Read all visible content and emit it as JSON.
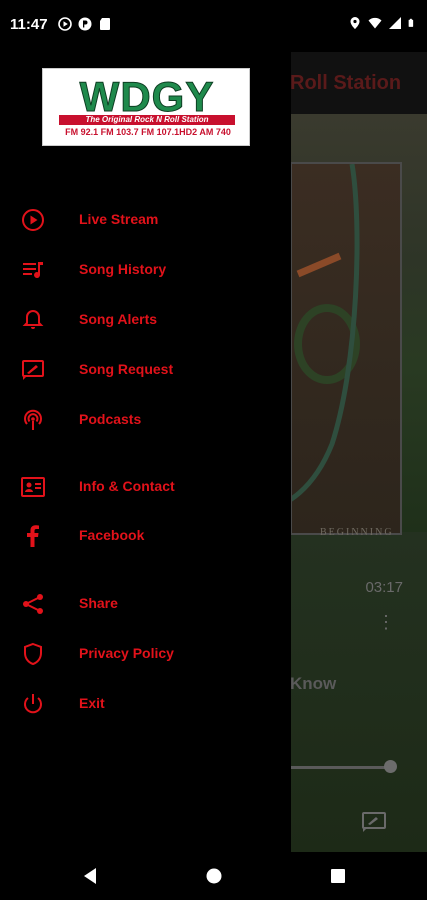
{
  "status_bar": {
    "time": "11:47",
    "left_icons": [
      "play-circle-icon",
      "podcast-status-icon",
      "sd-card-icon"
    ],
    "right_icons": [
      "location-icon",
      "wifi-icon",
      "cell-signal-icon",
      "battery-icon"
    ]
  },
  "background_app": {
    "title": "Roll Station",
    "art_caption": "BEGINNING",
    "duration": "03:17",
    "track_partial": "Know"
  },
  "drawer": {
    "logo": {
      "name": "WDGY",
      "tagline": "The Original Rock N Roll Station",
      "frequencies": "FM 92.1  FM 103.7  FM 107.1HD2  AM 740"
    },
    "items": [
      {
        "label": "Live Stream",
        "icon": "play-circle-icon"
      },
      {
        "label": "Song History",
        "icon": "playlist-icon"
      },
      {
        "label": "Song Alerts",
        "icon": "bell-icon"
      },
      {
        "label": "Song Request",
        "icon": "request-icon"
      },
      {
        "label": "Podcasts",
        "icon": "podcast-icon"
      },
      {
        "label": "Info & Contact",
        "icon": "contact-card-icon"
      },
      {
        "label": "Facebook",
        "icon": "facebook-icon"
      },
      {
        "label": "Share",
        "icon": "share-icon"
      },
      {
        "label": "Privacy Policy",
        "icon": "shield-icon"
      },
      {
        "label": "Exit",
        "icon": "power-icon"
      }
    ]
  },
  "nav_bar": {
    "buttons": [
      "back-icon",
      "home-icon",
      "recents-icon"
    ]
  },
  "colors": {
    "accent": "#e2121a",
    "logo_green": "#1f8a4c",
    "logo_red": "#c8102e"
  }
}
